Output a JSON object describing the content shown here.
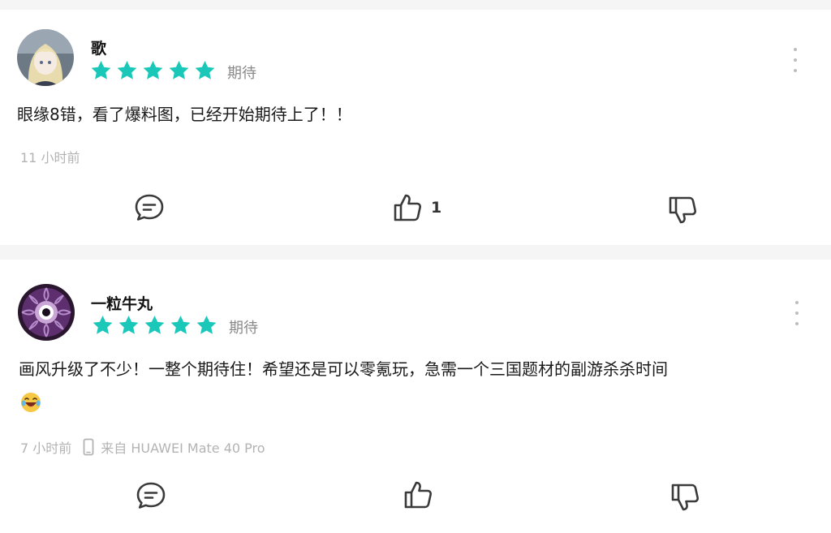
{
  "colors": {
    "star": "#19c8b9",
    "icon_stroke": "#3a3a3a",
    "muted": "#8a8a8a"
  },
  "comments": [
    {
      "username": "歌",
      "rating_stars": 5,
      "rating_label": "期待",
      "body": "眼缘8错，看了爆料图，已经开始期待上了！！",
      "time": "11 小时前",
      "likes": "1",
      "avatar_icon": "anime-girl-avatar"
    },
    {
      "username": "一粒牛丸",
      "rating_stars": 5,
      "rating_label": "期待",
      "body": "画风升级了不少！一整个期待住！希望还是可以零氪玩，急需一个三国题材的副游杀杀时间",
      "time": "7 小时前",
      "device": "来自 HUAWEI Mate 40 Pro",
      "avatar_icon": "purple-eye-avatar",
      "emoji_icon": "laughing-tears-emoji"
    }
  ]
}
